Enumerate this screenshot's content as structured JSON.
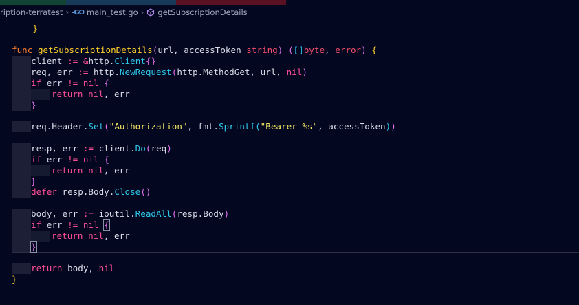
{
  "colors": {
    "background": "#040720",
    "keyword": "#fd4e96",
    "function_name": "#ffd02a",
    "call": "#2fc8e8",
    "string": "#f5e663",
    "type": "#f34d6b",
    "text": "#d8dbe6"
  },
  "breadcrumb": {
    "folder": "ription-terratest",
    "file_icon": "go-file-icon",
    "file_icon_glyph": "-GO",
    "file": "main_test.go",
    "symbol_icon": "method-icon",
    "symbol": "getSubscriptionDetails"
  },
  "code": {
    "l0": "}",
    "l2_kw": "func",
    "l2_fn": "getSubscriptionDetails",
    "l2_open": "(",
    "l2_params": "url, accessToken ",
    "l2_type": "string",
    "l2_close": ")",
    "l2_sp": " ",
    "l2_ret_open": "(",
    "l2_slice": "[]",
    "l2_byte": "byte",
    "l2_comma": ", ",
    "l2_error": "error",
    "l2_ret_close": ")",
    "l2_brace": " {",
    "l3_a": "client ",
    "l3_op": ":=",
    "l3_b": " ",
    "l3_amp": "&",
    "l3_c": "http.",
    "l3_call": "Client",
    "l3_braces": "{}",
    "l4_a": "req, err ",
    "l4_op": ":=",
    "l4_b": " http.",
    "l4_call": "NewRequest",
    "l4_open": "(",
    "l4_c": "http.MethodGet, url, ",
    "l4_nil": "nil",
    "l4_close": ")",
    "if_kw": "if",
    "if_mid": " err ",
    "if_op": "!=",
    "if_sp": " ",
    "if_nil": "nil",
    "if_brace": " {",
    "ret_kw": "return",
    "ret_sp": " ",
    "ret_nil": "nil",
    "ret_err": ", err",
    "close_brace": "}",
    "l9_a": "req.Header.",
    "l9_call": "Set",
    "l9_open": "(",
    "l9_str1": "\"Authorization\"",
    "l9_b": ", fmt.",
    "l9_call2": "Sprintf",
    "l9_open2": "(",
    "l9_str2": "\"Bearer %s\"",
    "l9_c": ", accessToken",
    "l9_close2": ")",
    "l9_close": ")",
    "l11_a": "resp, err ",
    "l11_op": ":=",
    "l11_b": " client.",
    "l11_call": "Do",
    "l11_open": "(",
    "l11_c": "req",
    "l11_close": ")",
    "l16_kw": "defer",
    "l16_a": " resp.Body.",
    "l16_call": "Close",
    "l16_parens": "()",
    "l18_a": "body, err ",
    "l18_op": ":=",
    "l18_b": " ioutil.",
    "l18_call": "ReadAll",
    "l18_open": "(",
    "l18_c": "resp.Body",
    "l18_close": ")",
    "l24_kw": "return",
    "l24_a": " body, ",
    "l24_nil": "nil",
    "l25": "}"
  }
}
